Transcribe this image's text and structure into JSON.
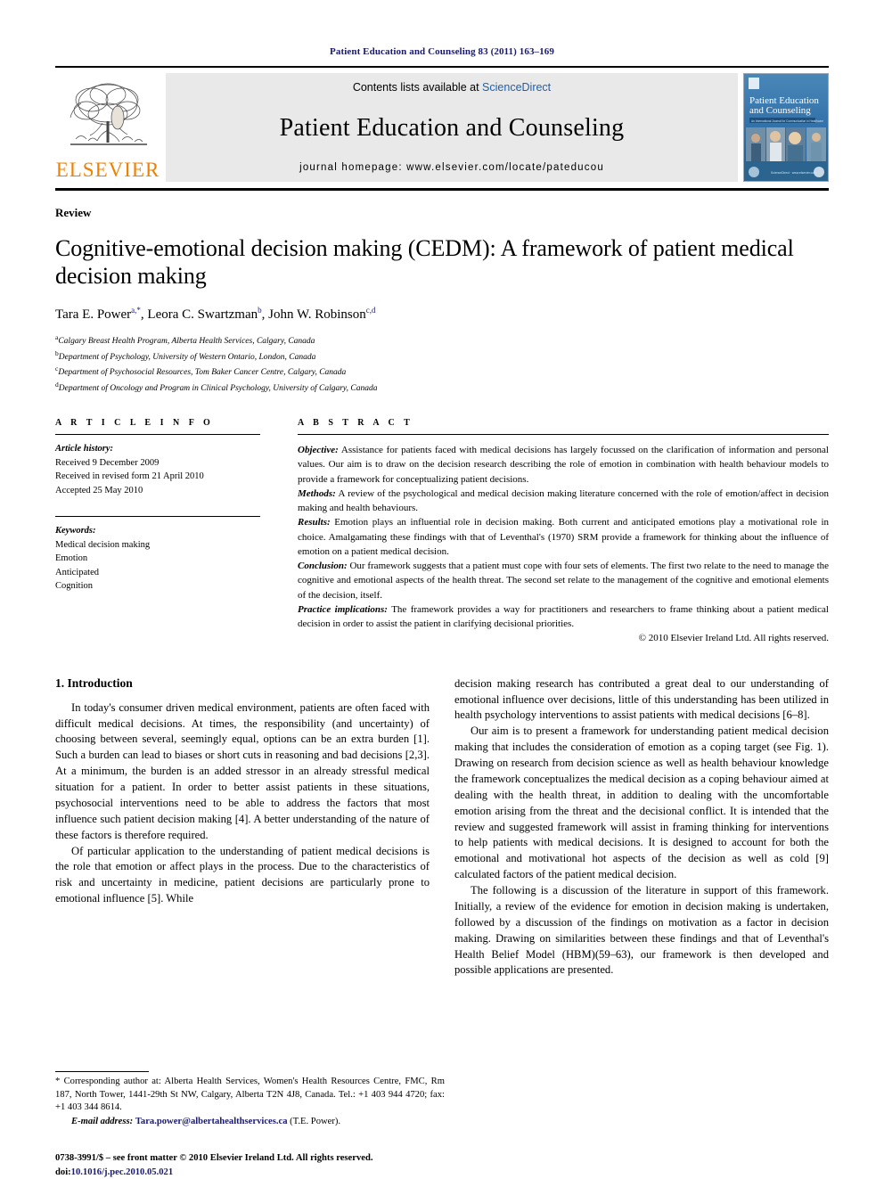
{
  "running_head": "Patient Education and Counseling 83 (2011) 163–169",
  "masthead": {
    "publisher_logo_label": "ELSEVIER",
    "contents_prefix": "Contents lists available at",
    "contents_link": "ScienceDirect",
    "journal_title": "Patient Education and Counseling",
    "homepage_line": "journal homepage: www.elsevier.com/locate/pateducou",
    "cover": {
      "title_line1": "Patient Education",
      "title_line2": "and Counseling",
      "subtitle": "An International Journal for Communication in Healthcare"
    }
  },
  "article": {
    "kind": "Review",
    "title": "Cognitive-emotional decision making (CEDM): A framework of patient medical decision making",
    "authors": [
      {
        "name": "Tara E. Power",
        "marks": "a,*"
      },
      {
        "name": "Leora C. Swartzman",
        "marks": "b"
      },
      {
        "name": "John W. Robinson",
        "marks": "c,d"
      }
    ],
    "affiliations": [
      {
        "mark": "a",
        "text": "Calgary Breast Health Program, Alberta Health Services, Calgary, Canada"
      },
      {
        "mark": "b",
        "text": "Department of Psychology, University of Western Ontario, London, Canada"
      },
      {
        "mark": "c",
        "text": "Department of Psychosocial Resources, Tom Baker Cancer Centre, Calgary, Canada"
      },
      {
        "mark": "d",
        "text": "Department of Oncology and Program in Clinical Psychology, University of Calgary, Canada"
      }
    ]
  },
  "article_info": {
    "heading": "A R T I C L E  I N F O",
    "history_label": "Article history:",
    "history": [
      "Received 9 December 2009",
      "Received in revised form 21 April 2010",
      "Accepted 25 May 2010"
    ],
    "keywords_label": "Keywords:",
    "keywords": [
      "Medical decision making",
      "Emotion",
      "Anticipated",
      "Cognition"
    ]
  },
  "abstract": {
    "heading": "A B S T R A C T",
    "sections": [
      {
        "label": "Objective:",
        "text": "Assistance for patients faced with medical decisions has largely focussed on the clarification of information and personal values. Our aim is to draw on the decision research describing the role of emotion in combination with health behaviour models to provide a framework for conceptualizing patient decisions."
      },
      {
        "label": "Methods:",
        "text": "A review of the psychological and medical decision making literature concerned with the role of emotion/affect in decision making and health behaviours."
      },
      {
        "label": "Results:",
        "text": "Emotion plays an influential role in decision making. Both current and anticipated emotions play a motivational role in choice. Amalgamating these findings with that of Leventhal's (1970) SRM provide a framework for thinking about the influence of emotion on a patient medical decision."
      },
      {
        "label": "Conclusion:",
        "text": "Our framework suggests that a patient must cope with four sets of elements. The first two relate to the need to manage the cognitive and emotional aspects of the health threat. The second set relate to the management of the cognitive and emotional elements of the decision, itself."
      },
      {
        "label": "Practice implications:",
        "text": "The framework provides a way for practitioners and researchers to frame thinking about a patient medical decision in order to assist the patient in clarifying decisional priorities."
      }
    ],
    "copyright": "© 2010 Elsevier Ireland Ltd. All rights reserved."
  },
  "body": {
    "section_heading": "1. Introduction",
    "left_paragraphs": [
      "In today's consumer driven medical environment, patients are often faced with difficult medical decisions. At times, the responsibility (and uncertainty) of choosing between several, seemingly equal, options can be an extra burden [1]. Such a burden can lead to biases or short cuts in reasoning and bad decisions [2,3]. At a minimum, the burden is an added stressor in an already stressful medical situation for a patient. In order to better assist patients in these situations, psychosocial interventions need to be able to address the factors that most influence such patient decision making [4]. A better understanding of the nature of these factors is therefore required.",
      "Of particular application to the understanding of patient medical decisions is the role that emotion or affect plays in the process. Due to the characteristics of risk and uncertainty in medicine, patient decisions are particularly prone to emotional influence [5]. While"
    ],
    "right_paragraphs": [
      "decision making research has contributed a great deal to our understanding of emotional influence over decisions, little of this understanding has been utilized in health psychology interventions to assist patients with medical decisions [6–8].",
      "Our aim is to present a framework for understanding patient medical decision making that includes the consideration of emotion as a coping target (see Fig. 1). Drawing on research from decision science as well as health behaviour knowledge the framework conceptualizes the medical decision as a coping behaviour aimed at dealing with the health threat, in addition to dealing with the uncomfortable emotion arising from the threat and the decisional conflict. It is intended that the review and suggested framework will assist in framing thinking for interventions to help patients with medical decisions. It is designed to account for both the emotional and motivational hot aspects of the decision as well as cold [9] calculated factors of the patient medical decision.",
      "The following is a discussion of the literature in support of this framework. Initially, a review of the evidence for emotion in decision making is undertaken, followed by a discussion of the findings on motivation as a factor in decision making. Drawing on similarities between these findings and that of Leventhal's Health Belief Model (HBM)(59–63), our framework is then developed and possible applications are presented."
    ]
  },
  "footnote": {
    "corresponding": "* Corresponding author at: Alberta Health Services, Women's Health Resources Centre, FMC, Rm 187, North Tower, 1441-29th St NW, Calgary, Alberta T2N 4J8, Canada. Tel.: +1 403 944 4720; fax: +1 403 344 8614.",
    "email_label": "E-mail address:",
    "email": "Tara.power@albertahealthservices.ca",
    "email_owner": "(T.E. Power)."
  },
  "imprint": {
    "issn_line": "0738-3991/$ – see front matter © 2010 Elsevier Ireland Ltd. All rights reserved.",
    "doi_label": "doi:",
    "doi": "10.1016/j.pec.2010.05.021"
  },
  "colors": {
    "link_blue": "#1f5fa9",
    "ref_blue": "#1a1a6e",
    "elsevier_orange": "#F08000",
    "masthead_gray": "#e9e9e9",
    "cover_blue": "#2f6fa8"
  }
}
